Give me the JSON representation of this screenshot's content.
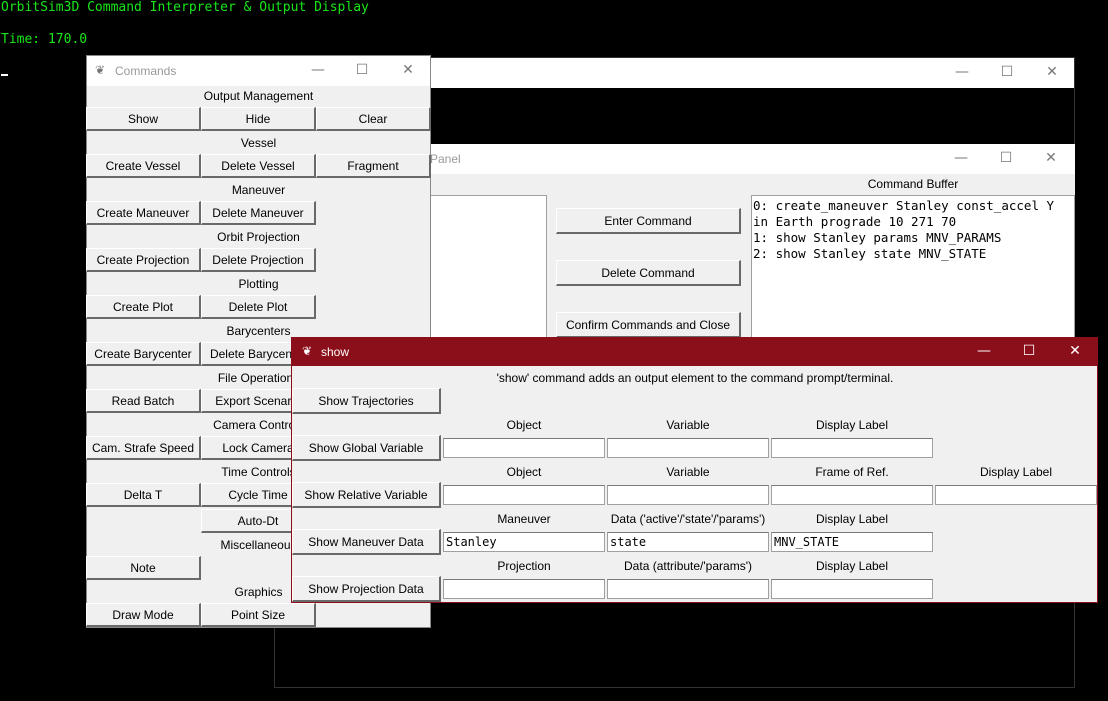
{
  "terminal": {
    "title": "OrbitSim3D Command Interpreter & Output Display",
    "time": "Time: 170.0"
  },
  "panel_window": {
    "title_partial": "Panel",
    "command_buffer_label": "Command Buffer",
    "buttons": {
      "enter": "Enter Command",
      "delete": "Delete Command",
      "confirm": "Confirm Commands and Close"
    },
    "buffer_lines": [
      "0: create_maneuver Stanley const_accel Y",
      "in Earth prograde 10 271 70",
      "1: show Stanley params MNV_PARAMS",
      "2: show Stanley state MNV_STATE"
    ]
  },
  "commands_window": {
    "title": "Commands",
    "sections": {
      "output": "Output Management",
      "vessel": "Vessel",
      "maneuver": "Maneuver",
      "orbit_projection": "Orbit Projection",
      "plotting": "Plotting",
      "barycenters": "Barycenters",
      "file_operations": "File Operations",
      "camera_controls": "Camera Controls",
      "time_controls": "Time Controls",
      "miscellaneous": "Miscellaneous",
      "graphics": "Graphics"
    },
    "buttons": {
      "show": "Show",
      "hide": "Hide",
      "clear": "Clear",
      "create_vessel": "Create Vessel",
      "delete_vessel": "Delete Vessel",
      "fragment": "Fragment",
      "create_maneuver": "Create Maneuver",
      "delete_maneuver": "Delete Maneuver",
      "create_projection": "Create Projection",
      "delete_projection": "Delete Projection",
      "create_plot": "Create Plot",
      "delete_plot": "Delete Plot",
      "create_barycenter": "Create Barycenter",
      "delete_barycenter": "Delete Barycenter",
      "read_batch": "Read Batch",
      "export_scenario": "Export Scenario",
      "cam_strafe_speed": "Cam. Strafe Speed",
      "lock_camera": "Lock Camera",
      "delta_t": "Delta T",
      "cycle_time": "Cycle Time",
      "auto_dt": "Auto-Dt",
      "note": "Note",
      "draw_mode": "Draw Mode",
      "point_size": "Point Size"
    }
  },
  "show_window": {
    "title": "show",
    "description": "'show' command adds an output element to the command prompt/terminal.",
    "buttons": {
      "trajectories": "Show Trajectories",
      "global_variable": "Show Global Variable",
      "relative_variable": "Show Relative Variable",
      "maneuver_data": "Show Maneuver Data",
      "projection_data": "Show Projection Data"
    },
    "global_headers": [
      "Object",
      "Variable",
      "Display Label"
    ],
    "relative_headers": [
      "Object",
      "Variable",
      "Frame of Ref.",
      "Display Label"
    ],
    "maneuver_headers": [
      "Maneuver",
      "Data ('active'/'state'/'params')",
      "Display Label"
    ],
    "maneuver_values": [
      "Stanley",
      "state",
      "MNV_STATE"
    ],
    "projection_headers": [
      "Projection",
      "Data (attribute/'params')",
      "Display Label"
    ]
  },
  "colors": {
    "terminal_text": "#19e619",
    "active_titlebar": "#8b0f1a"
  }
}
